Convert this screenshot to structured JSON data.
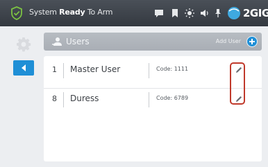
{
  "status_bar": {
    "prefix": "System ",
    "state": "Ready",
    "suffix": " To Arm",
    "brand": "2GIG",
    "icons": [
      "message-icon",
      "bookmark-icon",
      "brightness-icon",
      "volume-icon",
      "pin-icon"
    ]
  },
  "sidebar": {
    "settings_icon": "gear-icon",
    "back_icon": "back-arrow-icon"
  },
  "users_panel": {
    "title": "Users",
    "add_user_label": "Add User",
    "users": [
      {
        "number": "1",
        "name": "Master User",
        "code": "Code: 1111"
      },
      {
        "number": "8",
        "name": "Duress",
        "code": "Code: 6789"
      }
    ]
  },
  "colors": {
    "status_bar": "#3a3f46",
    "accent_blue": "#1f8fd6",
    "header_gray": "#b0b5bb",
    "highlight_red": "#c0392b",
    "background": "#eceef1"
  }
}
